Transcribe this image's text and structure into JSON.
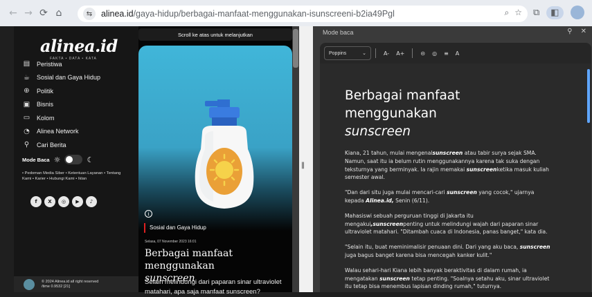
{
  "browser": {
    "url_host": "alinea.id",
    "url_path": "/gaya-hidup/berbagai-manfaat-menggunakan-isunscreeni-b2ia49Pgl"
  },
  "site": {
    "logo": "alinea.id",
    "tagline": "FAKTA • DATA • KATA",
    "menu": [
      {
        "label": "Peristiwa",
        "icon": "news-icon"
      },
      {
        "label": "Sosial dan Gaya Hidup",
        "icon": "coffee-icon"
      },
      {
        "label": "Politik",
        "icon": "globe-icon"
      },
      {
        "label": "Bisnis",
        "icon": "briefcase-icon"
      },
      {
        "label": "Kolom",
        "icon": "monitor-icon"
      },
      {
        "label": "Alinea Network",
        "icon": "network-icon"
      },
      {
        "label": "Cari Berita",
        "icon": "search-icon"
      }
    ],
    "read_mode_label": "Mode Baca",
    "footer_links": "• Pedoman Media Siber • Ketentuan Layanan • Tentang Kami • Karier • Hubungi Kami • Iklan",
    "socials": [
      "f",
      "X",
      "◎",
      "▶",
      "♪"
    ],
    "copyright_line1": "© 2024 Alinea.id all right reserved",
    "copyright_line2": "/time 0.9532 [21]"
  },
  "center": {
    "scroll_hint": "Scroll ke atas untuk melanjutkan",
    "category": "Sosial dan Gaya Hidup",
    "date": "Selasa, 07 November 2023 16:01",
    "title_main": "Berbagai manfaat menggunakan",
    "title_em": "sunscreen",
    "lead": "Selain melindungi dari paparan sinar ultraviolet matahari, apa saja manfaat sunscreen?"
  },
  "reader": {
    "header": "Mode baca",
    "font": "Poppins",
    "toolbar": [
      "A-",
      "A+",
      "⊝",
      "◎",
      "≡",
      "A"
    ],
    "title_main": "Berbagai manfaat menggunakan",
    "title_em": "sunscreen",
    "paragraphs": [
      [
        {
          "t": "Kiana, 21 tahun, mulai mengenal"
        },
        {
          "t": "sunscreen",
          "b": true
        },
        {
          "t": " atau tabir surya sejak SMA. Namun, saat itu ia belum rutin menggunakannya karena tak suka dengan teksturnya yang berminyak. Ia rajin memakai "
        },
        {
          "t": "sunscreen",
          "b": true
        },
        {
          "t": "ketika masuk kuliah semester awal."
        }
      ],
      [
        {
          "t": "\"Dan dari situ juga mulai mencari-cari "
        },
        {
          "t": "sunscreen",
          "b": true
        },
        {
          "t": " yang cocok,\" ujarnya kepada "
        },
        {
          "t": "Alinea.id,",
          "b": true
        },
        {
          "t": " Senin (6/11)."
        }
      ],
      [
        {
          "t": "Mahasiswi sebuah perguruan tinggi di Jakarta itu mengakui"
        },
        {
          "t": ",sunscreen",
          "b": true
        },
        {
          "t": "penting untuk melindungi wajah dari paparan sinar ultraviolet matahari. \"Ditambah cuaca di Indonesia, panas banget,\" kata dia."
        }
      ],
      [
        {
          "t": "\"Selain itu, buat meminimalisir penuaan dini. Dari yang aku baca, "
        },
        {
          "t": "sunscreen",
          "b": true
        },
        {
          "t": " juga bagus banget karena bisa mencegah kanker kulit.\""
        }
      ],
      [
        {
          "t": "Walau sehari-hari Kiana lebih banyak beraktivitas di dalam rumah, ia mengatakan "
        },
        {
          "t": "sunscreen",
          "b": true
        },
        {
          "t": " tetap penting. \"Soalnya setahu aku, sinar ultraviolet itu tetap bisa menembus lapisan dinding rumah,\" tuturnya."
        }
      ]
    ]
  },
  "colors": {
    "hero_top": "#40b6d9",
    "category_accent": "#e02020",
    "reader_scroll": "#5fa6ff"
  }
}
